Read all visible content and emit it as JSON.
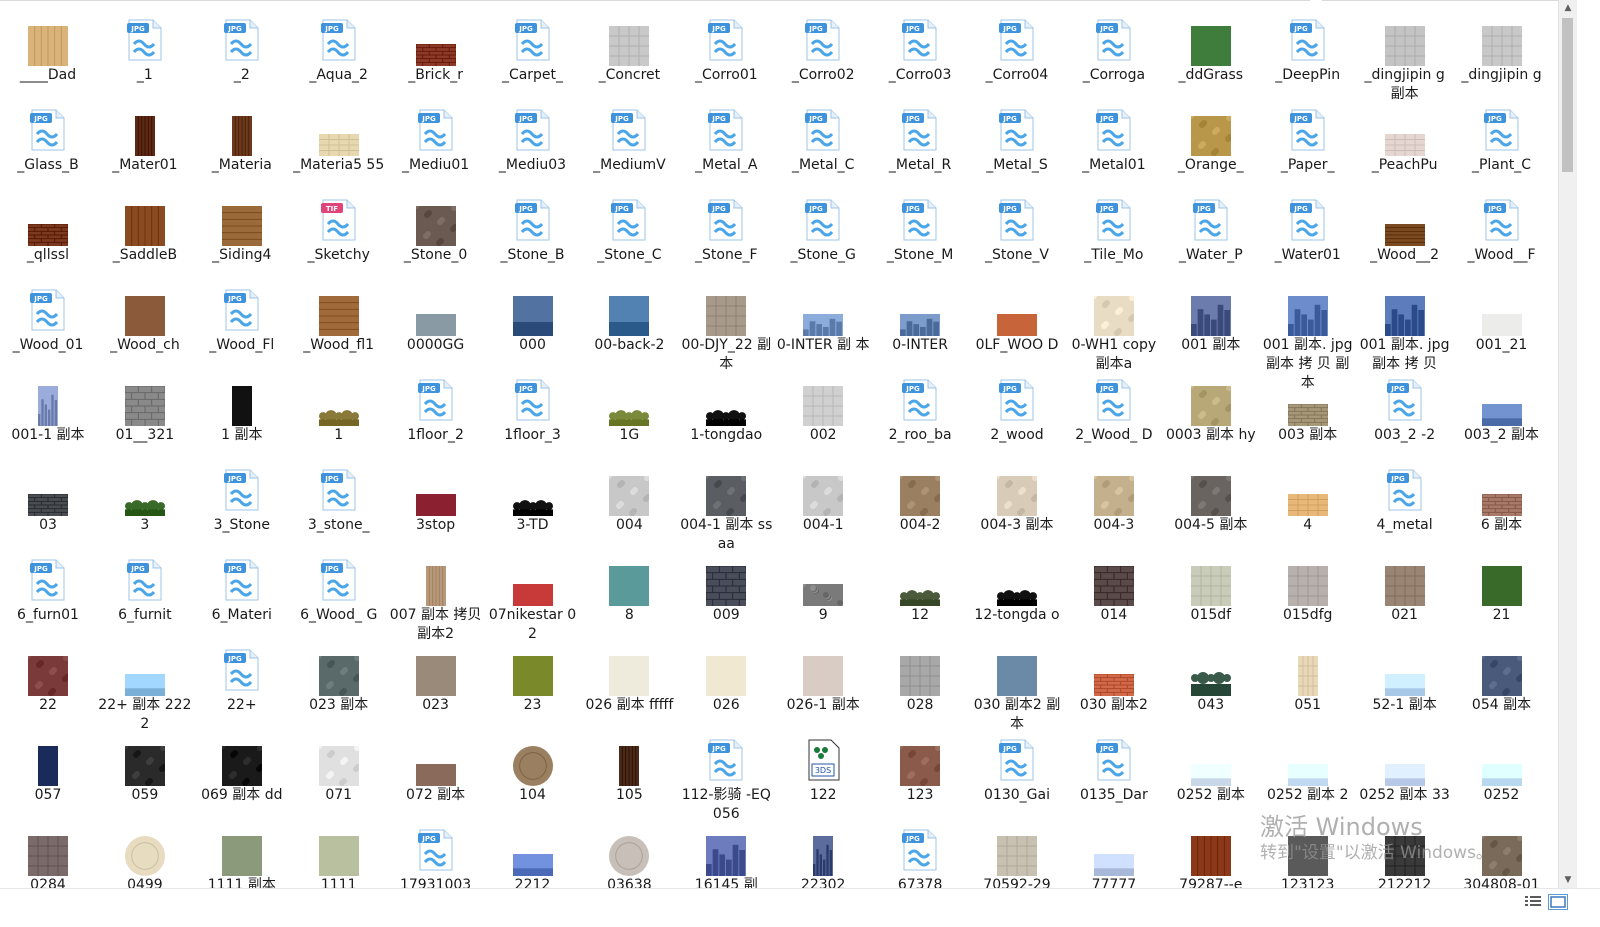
{
  "window": {
    "title": ""
  },
  "watermark": {
    "line1": "激活 Windows",
    "line2": "转到\"设置\"以激活 Windows。"
  },
  "files": [
    [
      "____Dad",
      "t:#d9b37a:planks"
    ],
    [
      "_1",
      "j"
    ],
    [
      "_2",
      "j"
    ],
    [
      "_Aqua_2",
      "j"
    ],
    [
      "_Brick_r",
      "t:#8c3b2a:brick:s"
    ],
    [
      "_Carpet_",
      "j"
    ],
    [
      "_Concret",
      "t:#c9c9c9:tiles"
    ],
    [
      "_Corro01",
      "j"
    ],
    [
      "_Corro02",
      "j"
    ],
    [
      "_Corro03",
      "j"
    ],
    [
      "_Corro04",
      "j"
    ],
    [
      "_Corroga",
      "j"
    ],
    [
      "_ddGrass",
      "t:#3f7d3c:flat"
    ],
    [
      "_DeepPin",
      "j"
    ],
    [
      "_dingjipin g 副本",
      "t:#c4c4c4:tiles"
    ],
    [
      "_dingjipin g",
      "t:#c8c8c8:tiles"
    ],
    [
      "_Glass_B",
      "j"
    ],
    [
      "_Mater01",
      "t:#5a2a16:planks:n"
    ],
    [
      "_Materia",
      "t:#6a3a20:planks:n"
    ],
    [
      "_Materia5 55",
      "t:#e8d8b0:tiles:s"
    ],
    [
      "_Mediu01",
      "j"
    ],
    [
      "_Mediu03",
      "j"
    ],
    [
      "_MediumV",
      "j"
    ],
    [
      "_Metal_A",
      "j"
    ],
    [
      "_Metal_C",
      "j"
    ],
    [
      "_Metal_R",
      "j"
    ],
    [
      "_Metal_S",
      "j"
    ],
    [
      "_Metal01",
      "j"
    ],
    [
      "_Orange_",
      "t:#b8974a:stone"
    ],
    [
      "_Paper_",
      "j"
    ],
    [
      "_PeachPu",
      "t:#e6d6d2:tiles:s"
    ],
    [
      "_Plant_C",
      "j"
    ],
    [
      "_qllssl",
      "t:#7a3a20:brick:s"
    ],
    [
      "_SaddleB",
      "t:#8a4a22:planks"
    ],
    [
      "_Siding4",
      "t:#9a6a3a:planks:h"
    ],
    [
      "_Sketchy",
      "tif"
    ],
    [
      "_Stone_0",
      "t:#6a5a52:stone"
    ],
    [
      "_Stone_B",
      "j"
    ],
    [
      "_Stone_C",
      "j"
    ],
    [
      "_Stone_F",
      "j"
    ],
    [
      "_Stone_G",
      "j"
    ],
    [
      "_Stone_M",
      "j"
    ],
    [
      "_Stone_V",
      "j"
    ],
    [
      "_Tile_Mo",
      "j"
    ],
    [
      "_Water_P",
      "j"
    ],
    [
      "_Water01",
      "j"
    ],
    [
      "_Wood__2",
      "t:#7a4a22:planks:s"
    ],
    [
      "_Wood__F",
      "j"
    ],
    [
      "_Wood_01",
      "j"
    ],
    [
      "_Wood_ch",
      "t:#8a5a3a:flat"
    ],
    [
      "_Wood_Fl",
      "j"
    ],
    [
      "_Wood_fl1",
      "t:#a06a3a:planks:h"
    ],
    [
      "0000GG",
      "t:#8a9aa4:flat:s"
    ],
    [
      "000",
      "t:#2a4a7a:sky"
    ],
    [
      "00-back-2",
      "t:#2a5a8a:sky"
    ],
    [
      "00-DJY_22 副本",
      "t:#a89a8a:tiles"
    ],
    [
      "0-INTER 副 本",
      "t:#5a7aaa:city:s"
    ],
    [
      "0-INTER",
      "t:#4a6a9a:city:s"
    ],
    [
      "0LF_WOO D",
      "t:#c8643a:flat:s"
    ],
    [
      "0-WH1 copy 副本a",
      "t:#e8dcc4:stone"
    ],
    [
      "001 副本",
      "t:#3a4a7a:city"
    ],
    [
      "001 副本. jpg 副本 拷 贝 副本",
      "t:#3a5a9a:city"
    ],
    [
      "001 副本. jpg 副本 拷 贝",
      "t:#2a4a8a:city"
    ],
    [
      "001_21",
      "t:#ececea:flat:s"
    ],
    [
      "001-1 副本",
      "t:#6a7aa8:city:n"
    ],
    [
      "01__321",
      "t:#8a8a8a:brick"
    ],
    [
      "1 副本",
      "t:#111111:flat:n"
    ],
    [
      "1",
      "t:#8a7a3a:trees:s"
    ],
    [
      "1floor_2",
      "j"
    ],
    [
      "1floor_3",
      "j"
    ],
    [
      "1G",
      "t:#7a8a3a:trees:s"
    ],
    [
      "1-tongdao",
      "t:#111111:trees:s"
    ],
    [
      "002",
      "t:#d0d0d0:tiles"
    ],
    [
      "2_roo_ba",
      "j"
    ],
    [
      "2_wood",
      "j"
    ],
    [
      "2_Wood_ D",
      "j"
    ],
    [
      "0003 副本 hy",
      "t:#b8a878:stone"
    ],
    [
      "003 副本",
      "t:#a8987a:brick:s"
    ],
    [
      "003_2 -2",
      "j"
    ],
    [
      "003_2 副本",
      "t:#4a6aa8:sky:s"
    ],
    [
      "03",
      "t:#4a4e52:brick:s"
    ],
    [
      "3",
      "t:#3a6a2a:trees:s"
    ],
    [
      "3_Stone",
      "j"
    ],
    [
      "3_stone_",
      "j"
    ],
    [
      "3stop",
      "t:#8a2030:flat:s"
    ],
    [
      "3-TD",
      "t:#111111:trees:s"
    ],
    [
      "004",
      "t:#c8c8c8:stone"
    ],
    [
      "004-1 副本 ssaa",
      "t:#5a5e62:stone"
    ],
    [
      "004-1",
      "t:#c8c8c8:stone"
    ],
    [
      "004-2",
      "t:#9a8060:stone"
    ],
    [
      "004-3 副本",
      "t:#d8ccb8:stone"
    ],
    [
      "004-3",
      "t:#c4b08c:stone"
    ],
    [
      "004-5 副本",
      "t:#6a6460:stone"
    ],
    [
      "4",
      "t:#e8b878:tiles:s"
    ],
    [
      "4_metal",
      "j"
    ],
    [
      "6 副本",
      "t:#a87a6a:brick:s"
    ],
    [
      "6_furn01",
      "j"
    ],
    [
      "6_furnit",
      "j"
    ],
    [
      "6_Materi",
      "j"
    ],
    [
      "6_Wood_ G",
      "j"
    ],
    [
      "007 副本 拷贝 副本2",
      "t:#b89a7a:planks:n"
    ],
    [
      "07nikestar 02",
      "t:#c83a3a:flat:s"
    ],
    [
      "8",
      "t:#5a9a9a:flat"
    ],
    [
      "009",
      "t:#4a4e5a:brick"
    ],
    [
      "9",
      "t:#7a7a7a:stone:s"
    ],
    [
      "12",
      "t:#4a5a3a:trees:s"
    ],
    [
      "12-tongda o",
      "t:#111111:trees:s"
    ],
    [
      "014",
      "t:#5a4a4a:brick"
    ],
    [
      "015df",
      "t:#c8ccb8:tiles"
    ],
    [
      "015dfg",
      "t:#b8b0ac:tiles"
    ],
    [
      "021",
      "t:#9a8474:tiles"
    ],
    [
      "21",
      "t:#3a6a2a:flat"
    ],
    [
      "22",
      "t:#7a3a3a:stone"
    ],
    [
      "22+ 副本 2222",
      "t:#7ab0d8:sky:s"
    ],
    [
      "22+",
      "j"
    ],
    [
      "023 副本",
      "t:#5a6a6a:stone"
    ],
    [
      "023",
      "t:#9a8a7a:flat"
    ],
    [
      "23",
      "t:#7a8a2a:flat"
    ],
    [
      "026 副本 fffff",
      "t:#eeeadc:flat"
    ],
    [
      "026",
      "t:#f0e8d0:flat"
    ],
    [
      "026-1 副本",
      "t:#d8ccc4:flat"
    ],
    [
      "028",
      "t:#a8a8a8:tiles"
    ],
    [
      "030 副本2 副本",
      "t:#6a8aa8:flat"
    ],
    [
      "030 副本2",
      "t:#d06a4a:brick:s"
    ],
    [
      "043",
      "t:#3a5a4a:trees"
    ],
    [
      "051",
      "t:#e8d8b8:tiles:n"
    ],
    [
      "52-1 副本",
      "t:#a8c8e8:sky:s"
    ],
    [
      "054 副本",
      "t:#4a5a7a:stone"
    ],
    [
      "057",
      "t:#1a2a5a:flat:n"
    ],
    [
      "059",
      "t:#2a2a2a:stone"
    ],
    [
      "069 副本 dd",
      "t:#1a1a1a:stone"
    ],
    [
      "071",
      "t:#e0e0e0:stone"
    ],
    [
      "072 副本",
      "t:#8a6a5a:flat:s"
    ],
    [
      "104",
      "t:#9a8060:circle"
    ],
    [
      "105",
      "t:#4a2a1a:planks:n"
    ],
    [
      "112-影骑 -EQ056",
      "j"
    ],
    [
      "122",
      "x3ds"
    ],
    [
      "123",
      "t:#8a5a4a:stone"
    ],
    [
      "0130_Gai",
      "j"
    ],
    [
      "0135_Dar",
      "j"
    ],
    [
      "0252 副本",
      "t:#c8d8e8:sky:s"
    ],
    [
      "0252 副本 2",
      "t:#c0d8f0:sky:s"
    ],
    [
      "0252 副本 33",
      "t:#b8c8e8:sky:s"
    ],
    [
      "0252",
      "t:#b8d8f0:sky:s"
    ],
    [
      "0284",
      "t:#7a6a6a:tiles"
    ],
    [
      "0499",
      "t:#e8dcc0:circle"
    ],
    [
      "1111 副本",
      "t:#8a9a7a:flat"
    ],
    [
      "1111",
      "t:#b8c0a0:flat"
    ],
    [
      "17931003",
      "j"
    ],
    [
      "2212",
      "t:#4a6ab8:sky:s"
    ],
    [
      "03638",
      "t:#c8c0b8:circle"
    ],
    [
      "16145 副",
      "t:#3a4a8a:city"
    ],
    [
      "22302",
      "t:#2a3a6a:city:n"
    ],
    [
      "67378",
      "j"
    ],
    [
      "70592-29",
      "t:#c8c0b0:tiles"
    ],
    [
      "77777",
      "t:#a8b8d8:sky:s"
    ],
    [
      "79287--e",
      "t:#8a3a1a:planks"
    ],
    [
      "123123",
      "t:#5a5a5a:flat"
    ],
    [
      "212212",
      "t:#3a3a3a:tiles"
    ],
    [
      "304808-01",
      "t:#7a6a5a:stone"
    ]
  ]
}
